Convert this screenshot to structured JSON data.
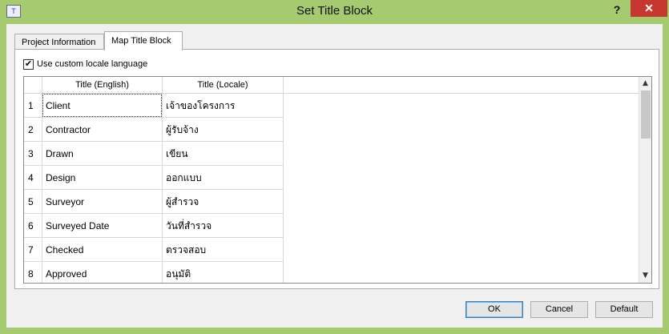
{
  "window": {
    "title": "Set Title Block",
    "icon_text": "T",
    "help_label": "?",
    "close_label": "✕"
  },
  "tabs": [
    {
      "label": "Project Information",
      "active": false
    },
    {
      "label": "Map Title Block",
      "active": true
    }
  ],
  "options": {
    "use_custom_locale": {
      "label": "Use custom locale language",
      "checked": true,
      "check_glyph": "✔"
    }
  },
  "grid": {
    "headers": {
      "index": "",
      "english": "Title (English)",
      "locale": "Title (Locale)"
    },
    "rows": [
      {
        "index": "1",
        "english": "Client",
        "locale": "เจ้าของโครงการ"
      },
      {
        "index": "2",
        "english": "Contractor",
        "locale": "ผู้รับจ้าง"
      },
      {
        "index": "3",
        "english": "Drawn",
        "locale": "เขียน"
      },
      {
        "index": "4",
        "english": "Design",
        "locale": "ออกแบบ"
      },
      {
        "index": "5",
        "english": "Surveyor",
        "locale": "ผู้สำรวจ"
      },
      {
        "index": "6",
        "english": "Surveyed Date",
        "locale": "วันที่สำรวจ"
      },
      {
        "index": "7",
        "english": "Checked",
        "locale": "ตรวจสอบ"
      },
      {
        "index": "8",
        "english": "Approved",
        "locale": "อนุมัติ"
      }
    ],
    "scroll_up_glyph": "▲",
    "scroll_down_glyph": "▼"
  },
  "buttons": {
    "ok": "OK",
    "cancel": "Cancel",
    "default": "Default"
  }
}
